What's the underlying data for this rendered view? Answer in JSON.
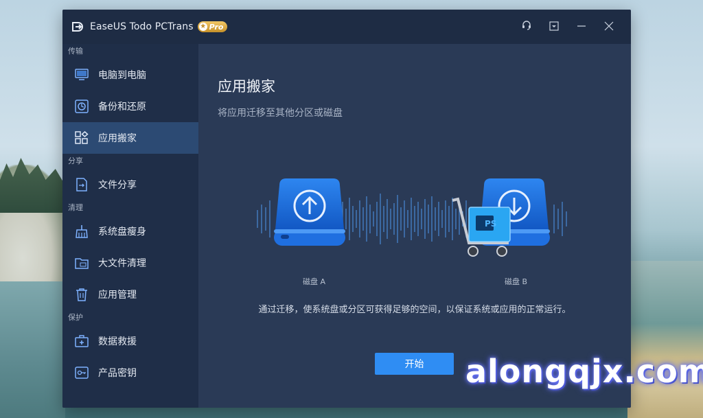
{
  "app": {
    "title": "EaseUS Todo PCTrans",
    "badge": "Pro"
  },
  "titlebar_controls": [
    {
      "name": "support-icon"
    },
    {
      "name": "menu-download-icon"
    },
    {
      "name": "minimize-icon"
    },
    {
      "name": "close-icon"
    }
  ],
  "sidebar": {
    "sections": [
      {
        "label": "传输",
        "items": [
          {
            "label": "电脑到电脑",
            "icon": "pc-to-pc-icon"
          },
          {
            "label": "备份和还原",
            "icon": "backup-restore-icon"
          },
          {
            "label": "应用搬家",
            "icon": "app-migration-icon",
            "active": true
          }
        ]
      },
      {
        "label": "分享",
        "items": [
          {
            "label": "文件分享",
            "icon": "file-share-icon"
          }
        ]
      },
      {
        "label": "清理",
        "items": [
          {
            "label": "系统盘瘦身",
            "icon": "broom-icon"
          },
          {
            "label": "大文件清理",
            "icon": "large-file-folder-icon"
          },
          {
            "label": "应用管理",
            "icon": "trash-icon"
          }
        ]
      },
      {
        "label": "保护",
        "items": [
          {
            "label": "数据救援",
            "icon": "rescue-kit-icon"
          },
          {
            "label": "产品密钥",
            "icon": "product-key-icon"
          }
        ]
      }
    ]
  },
  "main": {
    "title": "应用搬家",
    "subtitle": "将应用迁移至其他分区或磁盘",
    "disk_a_label": "磁盘 A",
    "disk_b_label": "磁盘 B",
    "description": "通过迁移，使系统盘或分区可获得足够的空间，以保证系统或应用的正常运行。",
    "start_button": "开始",
    "cart_badge": "PS"
  },
  "watermark": "alongqjx.com",
  "colors": {
    "accent": "#2f8df3",
    "sidebar_bg": "#1f2e48",
    "active_item_bg": "#2c4a73",
    "main_bg": "#2a3a56"
  }
}
